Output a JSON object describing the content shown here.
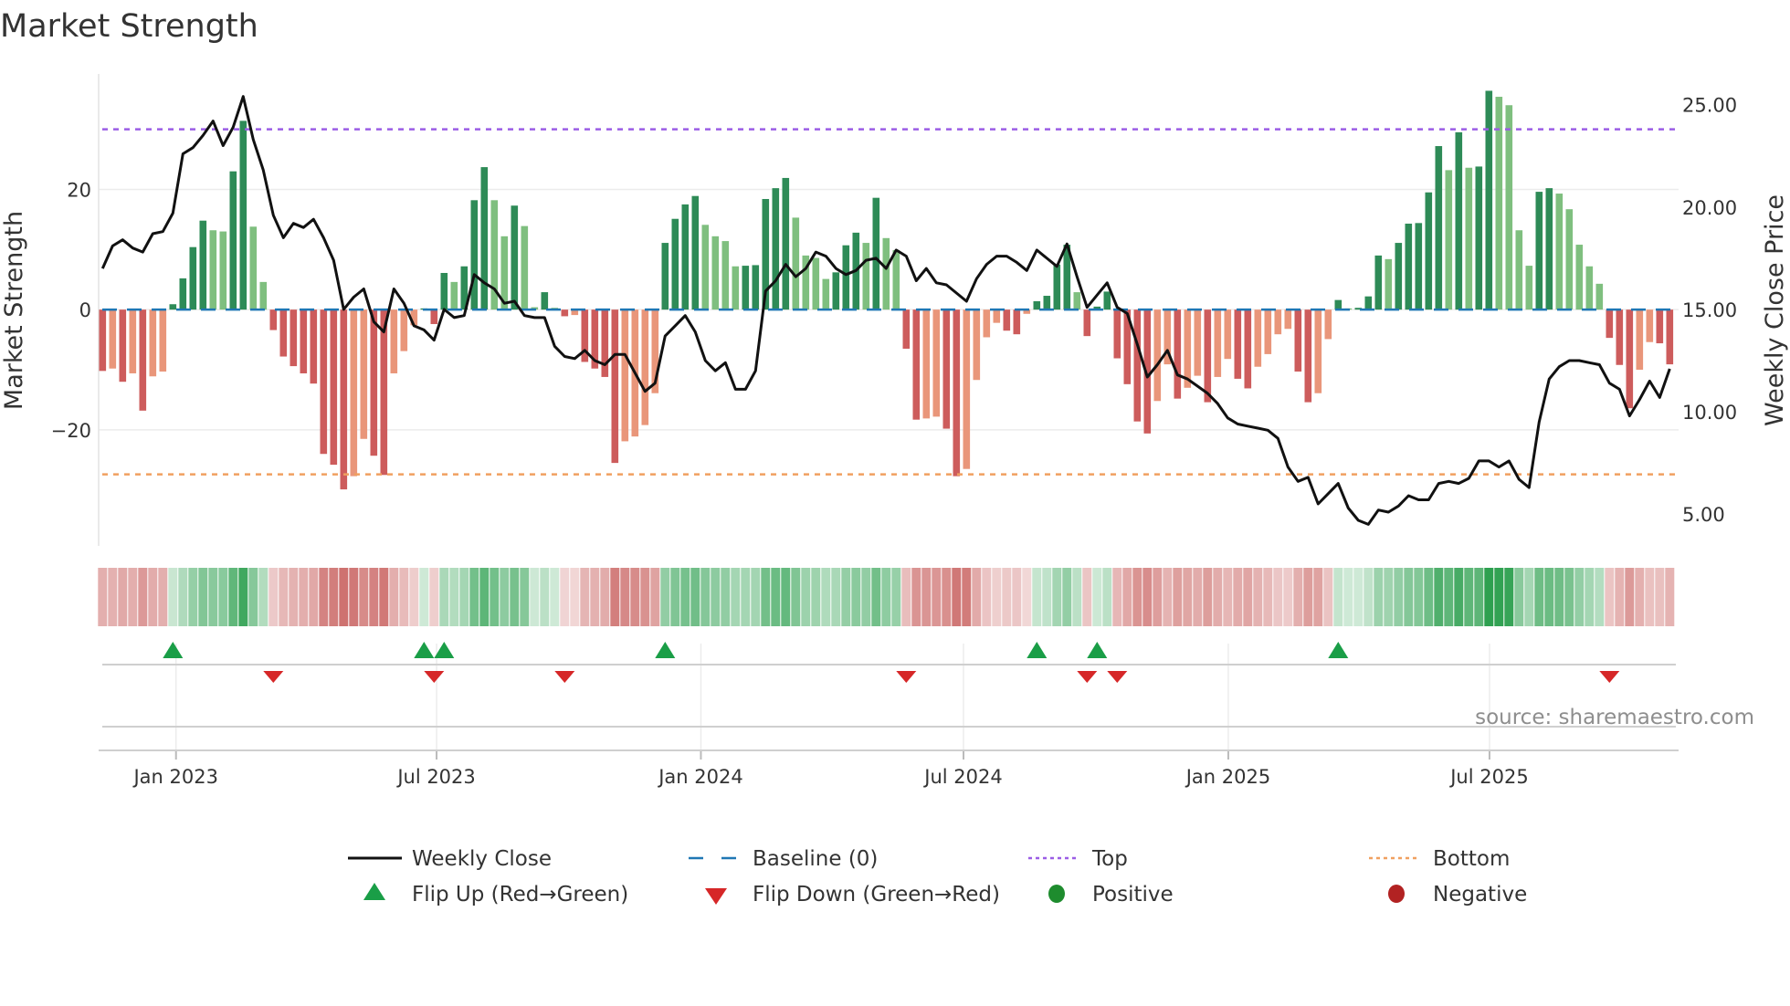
{
  "title": "Market Strength",
  "source": "source: sharemaestro.com",
  "colors": {
    "pos_strong": "#2e8b57",
    "pos_weak": "#7fbf7f",
    "neg_strong": "#cd5c5c",
    "neg_weak": "#e9967a",
    "close": "#111111",
    "baseline": "#1f77b4",
    "top": "#9b5de5",
    "bottom": "#f0a060",
    "flip_up": "#1a9e47",
    "flip_down": "#d62728",
    "positive": "#1e8c2e",
    "negative": "#b22222"
  },
  "legend": [
    {
      "label": "Weekly Close",
      "kind": "line"
    },
    {
      "label": "Baseline (0)",
      "kind": "dash"
    },
    {
      "label": "Top",
      "kind": "dot-purple"
    },
    {
      "label": "Bottom",
      "kind": "dot-orange"
    },
    {
      "label": "Flip Up (Red→Green)",
      "kind": "tri-up"
    },
    {
      "label": "Flip Down (Green→Red)",
      "kind": "tri-down"
    },
    {
      "label": "Positive",
      "kind": "circle-green"
    },
    {
      "label": "Negative",
      "kind": "circle-red"
    }
  ],
  "chart_data": {
    "type": "bar",
    "title": "Market Strength",
    "ylabel": "Market Strength",
    "y2label": "Weekly Close Price",
    "ylim": [
      -39.3,
      39.2
    ],
    "y2lim": [
      3.45,
      26.5
    ],
    "grid": true,
    "legend_position": "bottom",
    "y_ticks": [
      {
        "value": 20,
        "label": "20"
      },
      {
        "value": 0,
        "label": "0"
      },
      {
        "value": -20,
        "label": "−20"
      }
    ],
    "y2_ticks": [
      {
        "value": 25,
        "label": "25.00"
      },
      {
        "value": 20,
        "label": "20.00"
      },
      {
        "value": 15,
        "label": "15.00"
      },
      {
        "value": 10,
        "label": "10.00"
      },
      {
        "value": 5,
        "label": "5.00"
      }
    ],
    "x_ticks": [
      {
        "label": "Jan 2023",
        "week_index": 7.31
      },
      {
        "label": "Jul 2023",
        "week_index": 33.25
      },
      {
        "label": "Jan 2024",
        "week_index": 59.56
      },
      {
        "label": "Jul 2024",
        "week_index": 85.7
      },
      {
        "label": "Jan 2025",
        "week_index": 112.06
      },
      {
        "label": "Jul 2025",
        "week_index": 138.06
      }
    ],
    "top_level": 30,
    "bottom_level": -27.4,
    "baseline": 0,
    "strength": [
      -10.2,
      -9.8,
      -12.0,
      -10.6,
      -16.8,
      -11.1,
      -10.3,
      0.9,
      5.2,
      10.4,
      14.8,
      13.2,
      13.0,
      23.0,
      31.4,
      13.8,
      4.6,
      -3.4,
      -7.8,
      -9.4,
      -10.6,
      -12.3,
      -24.0,
      -25.8,
      -29.9,
      -27.7,
      -21.5,
      -24.3,
      -27.5,
      -10.6,
      -6.9,
      -2.6,
      0.2,
      -2.4,
      6.1,
      4.6,
      7.2,
      18.2,
      23.7,
      18.2,
      12.2,
      17.3,
      13.9,
      0.4,
      2.9,
      0.3,
      -1.1,
      -0.9,
      -8.7,
      -9.8,
      -11.2,
      -25.5,
      -21.9,
      -21.1,
      -19.2,
      -13.9,
      11.1,
      15.1,
      17.5,
      18.9,
      14.1,
      12.2,
      11.4,
      7.2,
      7.3,
      7.4,
      18.4,
      20.2,
      21.9,
      15.3,
      9.0,
      8.6,
      5.1,
      6.2,
      10.7,
      12.8,
      11.1,
      18.6,
      11.9,
      9.9,
      -6.5,
      -18.3,
      -18.1,
      -17.8,
      -19.8,
      -27.7,
      -26.5,
      -11.7,
      -4.6,
      -2.2,
      -3.5,
      -4.1,
      -0.7,
      1.4,
      2.3,
      7.5,
      10.8,
      2.9,
      -4.4,
      0.5,
      3.0,
      -8.1,
      -12.4,
      -18.6,
      -20.6,
      -15.2,
      -9.1,
      -14.8,
      -13.0,
      -11.0,
      -15.4,
      -11.2,
      -8.2,
      -11.5,
      -13.1,
      -9.5,
      -7.4,
      -4.1,
      -3.2,
      -10.3,
      -15.4,
      -13.9,
      -4.9,
      1.6,
      0.2,
      0.3,
      2.2,
      9.0,
      8.4,
      11.1,
      14.3,
      14.4,
      19.5,
      27.2,
      23.2,
      29.5,
      23.6,
      23.8,
      36.4,
      35.4,
      34.0,
      13.2,
      7.3,
      19.6,
      20.2,
      19.3,
      16.7,
      10.8,
      7.2,
      4.3,
      -4.7,
      -9.2,
      -16.4,
      -10.0,
      -5.4,
      -5.6,
      -9.1
    ],
    "weekly_close": [
      17.0,
      18.1,
      18.4,
      18.0,
      17.8,
      18.7,
      18.8,
      19.7,
      22.6,
      22.9,
      23.5,
      24.2,
      23.0,
      23.9,
      25.4,
      23.3,
      21.8,
      19.6,
      18.5,
      19.2,
      19.0,
      19.4,
      18.5,
      17.4,
      15.0,
      15.6,
      16.0,
      14.4,
      13.9,
      16.0,
      15.3,
      14.2,
      14.0,
      13.5,
      15.0,
      14.6,
      14.7,
      16.7,
      16.3,
      16.0,
      15.3,
      15.4,
      14.7,
      14.6,
      14.6,
      13.2,
      12.7,
      12.6,
      13.0,
      12.5,
      12.3,
      12.8,
      12.8,
      11.9,
      11.0,
      11.4,
      13.7,
      14.2,
      14.7,
      13.9,
      12.5,
      12.0,
      12.4,
      11.1,
      11.1,
      12.0,
      15.9,
      16.4,
      17.2,
      16.6,
      17.0,
      17.8,
      17.6,
      17.0,
      16.7,
      16.9,
      17.4,
      17.5,
      17.0,
      17.9,
      17.6,
      16.4,
      17.0,
      16.3,
      16.2,
      15.8,
      15.4,
      16.5,
      17.2,
      17.6,
      17.6,
      17.3,
      16.9,
      17.9,
      17.5,
      17.1,
      18.2,
      16.6,
      15.1,
      15.7,
      16.3,
      15.1,
      14.8,
      13.3,
      11.7,
      12.3,
      13.0,
      11.8,
      11.6,
      11.25,
      10.9,
      10.4,
      9.7,
      9.4,
      9.3,
      9.2,
      9.1,
      8.7,
      7.3,
      6.6,
      6.8,
      5.5,
      6.0,
      6.5,
      5.3,
      4.7,
      4.5,
      5.2,
      5.1,
      5.4,
      5.9,
      5.7,
      5.7,
      6.5,
      6.6,
      6.5,
      6.75,
      7.6,
      7.6,
      7.3,
      7.6,
      6.7,
      6.3,
      9.5,
      11.6,
      12.2,
      12.5,
      12.5,
      12.4,
      12.3,
      11.4,
      11.1,
      9.8,
      10.6,
      11.5,
      10.7,
      12.1
    ],
    "flip_up_weeks": [
      7,
      32,
      34,
      56,
      93,
      99,
      123
    ],
    "flip_down_weeks": [
      17,
      33,
      46,
      80,
      98,
      101,
      150
    ]
  }
}
